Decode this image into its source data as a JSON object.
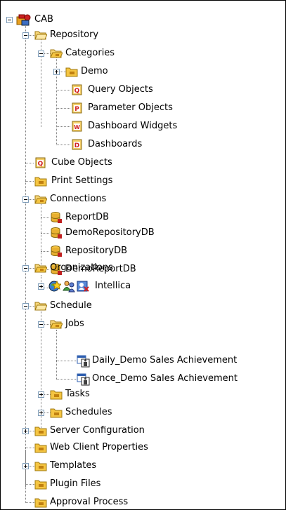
{
  "tree": {
    "root": "CAB",
    "repository": "Repository",
    "categories": "Categories",
    "demo": "Demo",
    "query_objects": "Query Objects",
    "parameter_objects": "Parameter Objects",
    "dashboard_widgets": "Dashboard Widgets",
    "dashboards": "Dashboards",
    "cube_objects": "Cube Objects",
    "print_settings": "Print Settings",
    "connections": "Connections",
    "connection_items": [
      "ReportDB",
      "DemoRepositoryDB",
      "RepositoryDB",
      "DemoReportDB"
    ],
    "organizations": "Organizations",
    "intellica": "Intellica",
    "schedule": "Schedule",
    "jobs": "Jobs",
    "job_items": [
      "Daily_Demo Sales Achievement",
      "Once_Demo Sales Achievement"
    ],
    "tasks": "Tasks",
    "schedules": "Schedules",
    "server_configuration": "Server Configuration",
    "web_client_properties": "Web Client Properties",
    "templates": "Templates",
    "plugin_files": "Plugin Files",
    "approval_process": "Approval Process"
  },
  "badges": {
    "query": "Q",
    "parameter": "P",
    "widget": "W",
    "dashboard": "D"
  }
}
